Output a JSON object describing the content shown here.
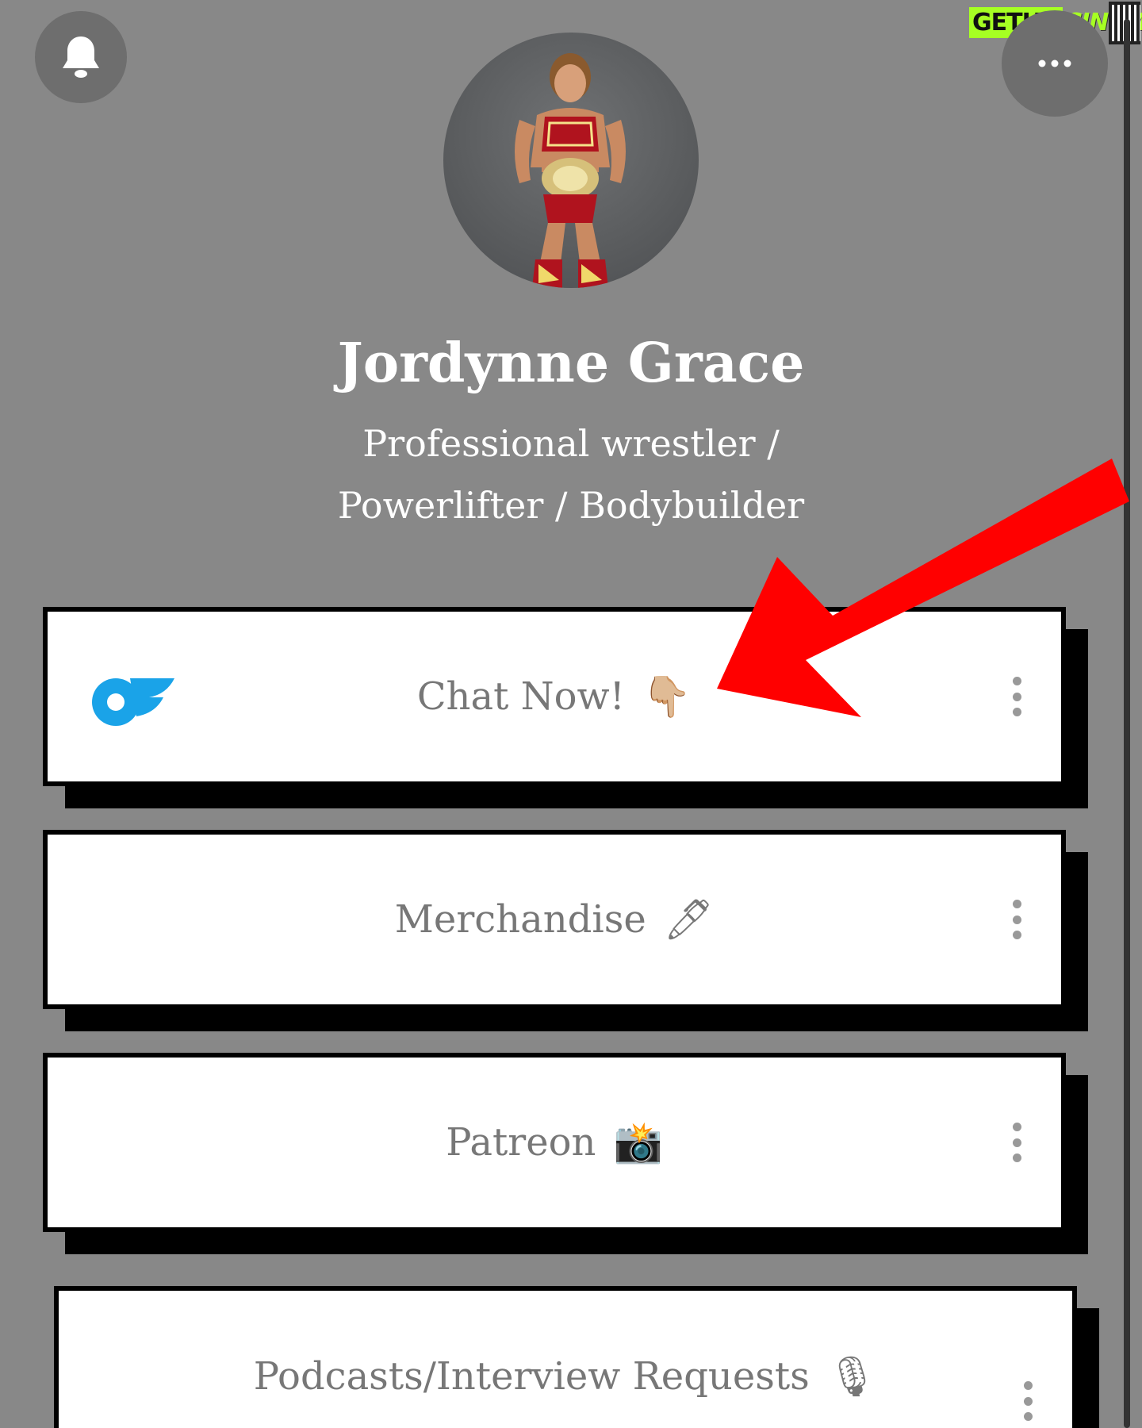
{
  "watermark": {
    "part1": "GETHU",
    "part2": "CINEMA"
  },
  "profile": {
    "name": "Jordynne Grace",
    "bio_line1": "Professional wrestler /",
    "bio_line2": "Powerlifter / Bodybuilder"
  },
  "links": [
    {
      "label": "Chat Now!",
      "emoji": "👇🏼"
    },
    {
      "label": "Merchandise",
      "emoji": "🖊"
    },
    {
      "label": "Patreon",
      "emoji": "📸"
    },
    {
      "label": "Podcasts/Interview Requests",
      "emoji": "🎙"
    }
  ],
  "colors": {
    "background": "#888888",
    "accent_arrow": "#ff0000",
    "onlyfans_blue": "#1aa3e8"
  },
  "icons": {
    "notification": "bell-icon",
    "more": "more-horizontal-icon",
    "item_menu": "more-vertical-icon",
    "link_logo": "onlyfans-logo-icon"
  }
}
